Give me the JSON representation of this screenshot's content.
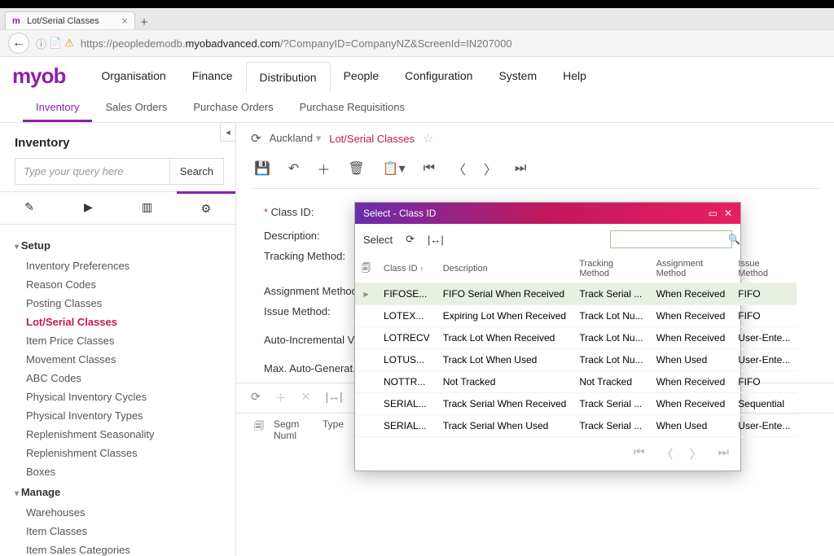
{
  "browser": {
    "tab_title": "Lot/Serial Classes",
    "url_left": "https://peopledemodb.",
    "url_domain": "myobadvanced.com",
    "url_right": "/?CompanyID=CompanyNZ&ScreenId=IN207000"
  },
  "header": {
    "logo": "myob",
    "nav": [
      "Organisation",
      "Finance",
      "Distribution",
      "People",
      "Configuration",
      "System",
      "Help"
    ],
    "active_nav_index": 2,
    "subnav": [
      "Inventory",
      "Sales Orders",
      "Purchase Orders",
      "Purchase Requisitions"
    ],
    "active_subnav_index": 0
  },
  "sidebar": {
    "title": "Inventory",
    "search_placeholder": "Type your query here",
    "search_button": "Search",
    "sections": [
      {
        "label": "Setup",
        "items": [
          "Inventory Preferences",
          "Reason Codes",
          "Posting Classes",
          "Lot/Serial Classes",
          "Item Price Classes",
          "Movement Classes",
          "ABC Codes",
          "Physical Inventory Cycles",
          "Physical Inventory Types",
          "Replenishment Seasonality",
          "Replenishment Classes",
          "Boxes"
        ],
        "active_index": 3
      },
      {
        "label": "Manage",
        "items": [
          "Warehouses",
          "Item Classes",
          "Item Sales Categories"
        ],
        "active_index": -1
      }
    ]
  },
  "breadcrumb": {
    "company": "Auckland",
    "page": "Lot/Serial Classes"
  },
  "form": {
    "labels": {
      "class_id": "Class ID:",
      "description": "Description:",
      "tracking": "Tracking Method:",
      "assignment": "Assignment Method:",
      "issue": "Issue Method:",
      "autoinc": "Auto-Incremental V...",
      "maxauto": "Max. Auto-Generat..."
    },
    "grid_cols": {
      "segm": "Segm Numl",
      "type": "Type"
    }
  },
  "popup": {
    "title": "Select - Class ID",
    "select_label": "Select",
    "columns": [
      "Class ID",
      "Description",
      "Tracking Method",
      "Assignment Method",
      "Issue Method"
    ],
    "rows": [
      {
        "id": "FIFOSE...",
        "desc": "FIFO Serial When Received",
        "trk": "Track Serial ...",
        "asn": "When Received",
        "iss": "FIFO",
        "sel": true
      },
      {
        "id": "LOTEX...",
        "desc": "Expiring Lot When Received",
        "trk": "Track Lot Nu...",
        "asn": "When Received",
        "iss": "FIFO"
      },
      {
        "id": "LOTRECV",
        "desc": "Track Lot When Received",
        "trk": "Track Lot Nu...",
        "asn": "When Received",
        "iss": "User-Ente..."
      },
      {
        "id": "LOTUS...",
        "desc": "Track Lot When Used",
        "trk": "Track Lot Nu...",
        "asn": "When Used",
        "iss": "User-Ente..."
      },
      {
        "id": "NOTTR...",
        "desc": "Not Tracked",
        "trk": "Not Tracked",
        "asn": "When Received",
        "iss": "FIFO"
      },
      {
        "id": "SERIAL...",
        "desc": "Track Serial When Received",
        "trk": "Track Serial ...",
        "asn": "When Received",
        "iss": "Sequential"
      },
      {
        "id": "SERIAL...",
        "desc": "Track Serial When Used",
        "trk": "Track Serial ...",
        "asn": "When Used",
        "iss": "User-Ente..."
      }
    ]
  }
}
